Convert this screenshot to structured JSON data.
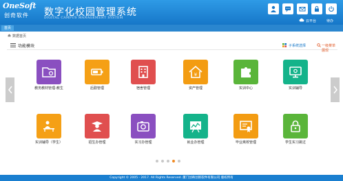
{
  "header": {
    "logo_text": "OneSoft",
    "logo_sub": "创奇软件",
    "title": "数字化校园管理系统",
    "subtitle": "DIGITAL CAMPUS MANAGEMENT SYSTEM",
    "buttons": [
      {
        "name": "user-icon"
      },
      {
        "name": "chat-icon"
      },
      {
        "name": "mail-icon"
      },
      {
        "name": "lock-icon"
      },
      {
        "name": "power-icon"
      }
    ],
    "links": {
      "cloud": "云平台",
      "tasks": "待办"
    }
  },
  "tabbar": {
    "active_tab": "首页"
  },
  "breadcrumb": "数据首页",
  "section": {
    "title": "功能模块",
    "system_select": "子系统选择",
    "switch_link": "一级菜单展现"
  },
  "colors": {
    "header": "#1a7fd0",
    "purple": "#8a4fc0",
    "orange": "#f5a016",
    "red": "#e04f4f",
    "amber": "#f39c12",
    "green": "#5ab53a",
    "teal": "#14b38a"
  },
  "tiles": [
    {
      "label": "教务教材管理-教生",
      "icon": "folder-icon",
      "color": "#8a4fc0"
    },
    {
      "label": "后勤管理",
      "icon": "battery-icon",
      "color": "#f5a016"
    },
    {
      "label": "宿舍管理",
      "icon": "building-icon",
      "color": "#e04f4f"
    },
    {
      "label": "资产管理",
      "icon": "yen-house-icon",
      "color": "#f39c12"
    },
    {
      "label": "实训中心",
      "icon": "puzzle-icon",
      "color": "#5ab53a"
    },
    {
      "label": "实训辅导",
      "icon": "monitor-icon",
      "color": "#14b38a"
    },
    {
      "label": "实训辅导（学生）",
      "icon": "student-desk-icon",
      "color": "#f5a016"
    },
    {
      "label": "招生办管理",
      "icon": "graduate-icon",
      "color": "#e04f4f"
    },
    {
      "label": "实习办管理",
      "icon": "camera-icon",
      "color": "#8a4fc0"
    },
    {
      "label": "就业办管理",
      "icon": "chart-board-icon",
      "color": "#14b38a"
    },
    {
      "label": "毕业离校管理",
      "icon": "certificate-icon",
      "color": "#f39c12"
    },
    {
      "label": "学生实习跳过",
      "icon": "padlock-icon",
      "color": "#5ab53a"
    }
  ],
  "pager": {
    "count": 5,
    "active": 3
  },
  "footer": "Copyright © 2005 - 2017. All Rights Reserved. 厦门创奇创新软件有限公司 版权所有"
}
